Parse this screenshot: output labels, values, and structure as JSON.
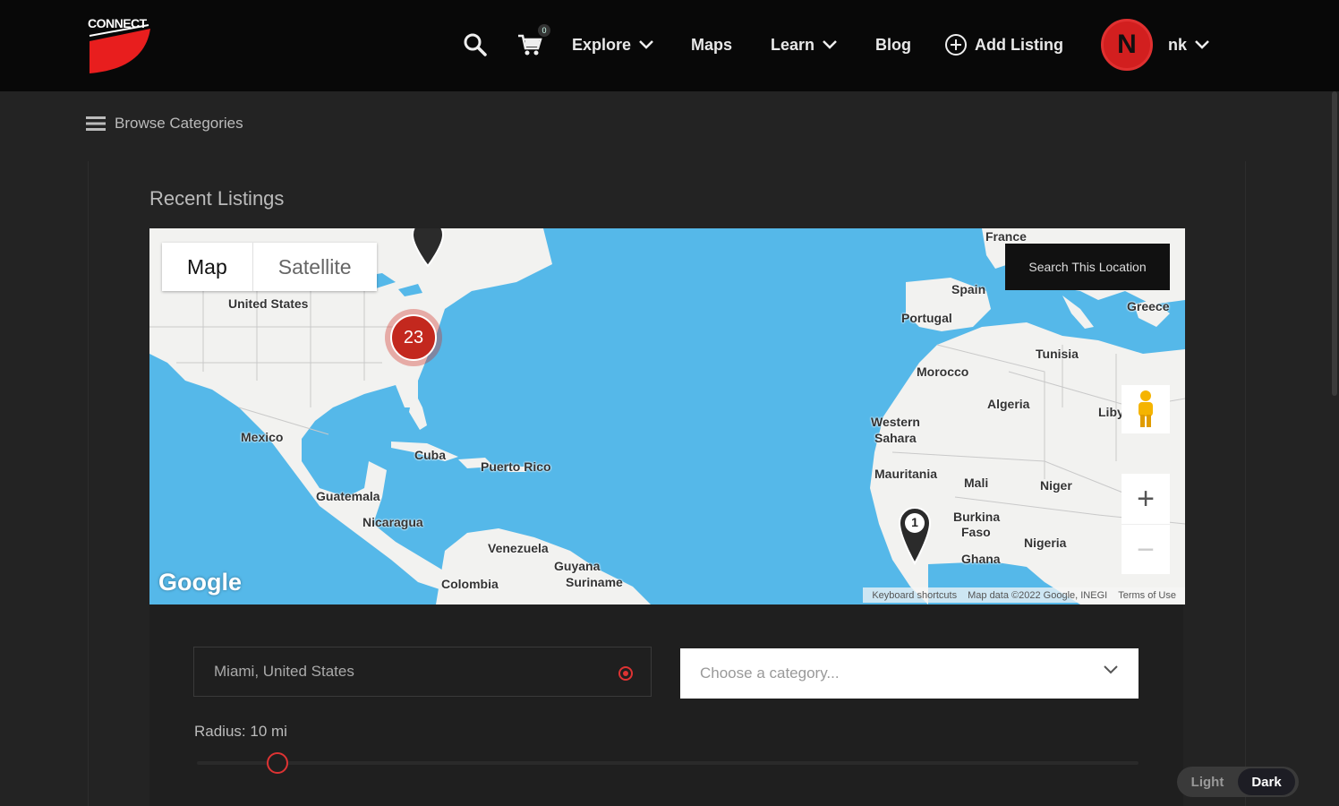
{
  "header": {
    "logo_text": "CONNECT",
    "nav": {
      "explore": "Explore",
      "maps": "Maps",
      "learn": "Learn",
      "blog": "Blog",
      "add_listing": "Add Listing"
    },
    "cart_count": "0",
    "avatar_letter": "N",
    "user_name": "nk"
  },
  "browse": {
    "label": "Browse Categories"
  },
  "main": {
    "section_title": "Recent Listings"
  },
  "map": {
    "type_map": "Map",
    "type_satellite": "Satellite",
    "search_location": "Search This Location",
    "cluster_count": "23",
    "marker_count": "1",
    "google_logo": "Google",
    "attribution": {
      "shortcuts": "Keyboard shortcuts",
      "data": "Map data ©2022 Google, INEGI",
      "terms": "Terms of Use"
    },
    "labels": {
      "united_states": "United States",
      "mexico": "Mexico",
      "cuba": "Cuba",
      "puerto_rico": "Puerto Rico",
      "guatemala": "Guatemala",
      "nicaragua": "Nicaragua",
      "venezuela": "Venezuela",
      "colombia": "Colombia",
      "guyana": "Guyana",
      "suriname": "Suriname",
      "france": "France",
      "spain": "Spain",
      "portugal": "Portugal",
      "greece": "Greece",
      "tunisia": "Tunisia",
      "morocco": "Morocco",
      "algeria": "Algeria",
      "libya": "Liby",
      "western_sahara_1": "Western",
      "western_sahara_2": "Sahara",
      "mauritania": "Mauritania",
      "mali": "Mali",
      "niger": "Niger",
      "burkina_1": "Burkina",
      "burkina_2": "Faso",
      "nigeria": "Nigeria",
      "ghana": "Ghana"
    },
    "zoom_in": "+",
    "zoom_out": "−"
  },
  "search_form": {
    "location_value": "Miami, United States",
    "category_placeholder": "Choose a category...",
    "radius_label": "Radius: 10 mi",
    "radius_miles": 10
  },
  "theme_toggle": {
    "light": "Light",
    "dark": "Dark",
    "active": "Dark"
  },
  "colors": {
    "accent": "#d32f2f",
    "header_bg": "#080808",
    "page_bg": "#232323",
    "water": "#55b8e9",
    "land": "#f2f2f0"
  }
}
